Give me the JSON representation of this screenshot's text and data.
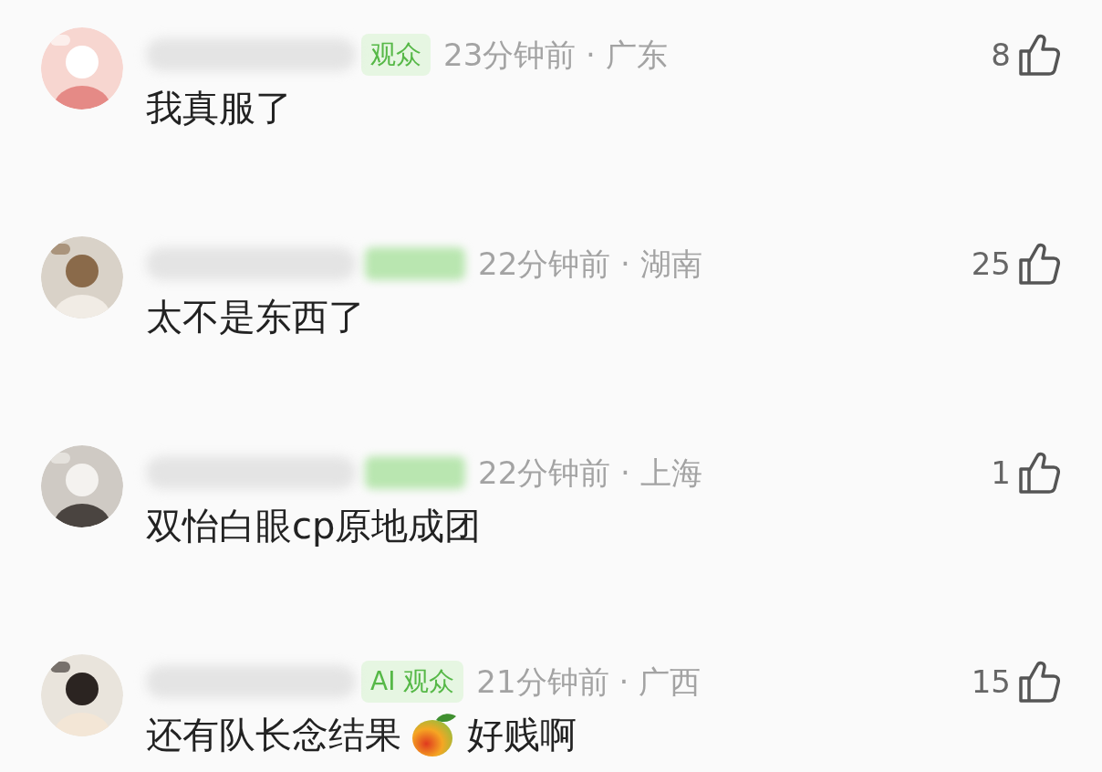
{
  "comments": [
    {
      "avatar": {
        "kind": "picture"
      },
      "badge": "观众",
      "meta": "23分钟前 · 广东",
      "likes": "8",
      "parts": [
        {
          "kind": "text",
          "text": "我真服了"
        }
      ]
    },
    {
      "avatar": {
        "kind": "picture"
      },
      "meta": "22分钟前 · 湖南",
      "likes": "25",
      "parts": [
        {
          "kind": "text",
          "text": "太不是东西了"
        }
      ]
    },
    {
      "avatar": {
        "kind": "picture"
      },
      "meta": "22分钟前 · 上海",
      "likes": "1",
      "parts": [
        {
          "kind": "text",
          "text": "双怡白眼cp原地成团"
        }
      ]
    },
    {
      "avatar": {
        "kind": "picture"
      },
      "badge": "AI 观众",
      "meta": "21分钟前 · 广西",
      "likes": "15",
      "parts": [
        {
          "kind": "text",
          "text": "还有队长念结果"
        },
        {
          "kind": "emoji"
        },
        {
          "kind": "text",
          "text": "好贱啊"
        }
      ]
    }
  ]
}
